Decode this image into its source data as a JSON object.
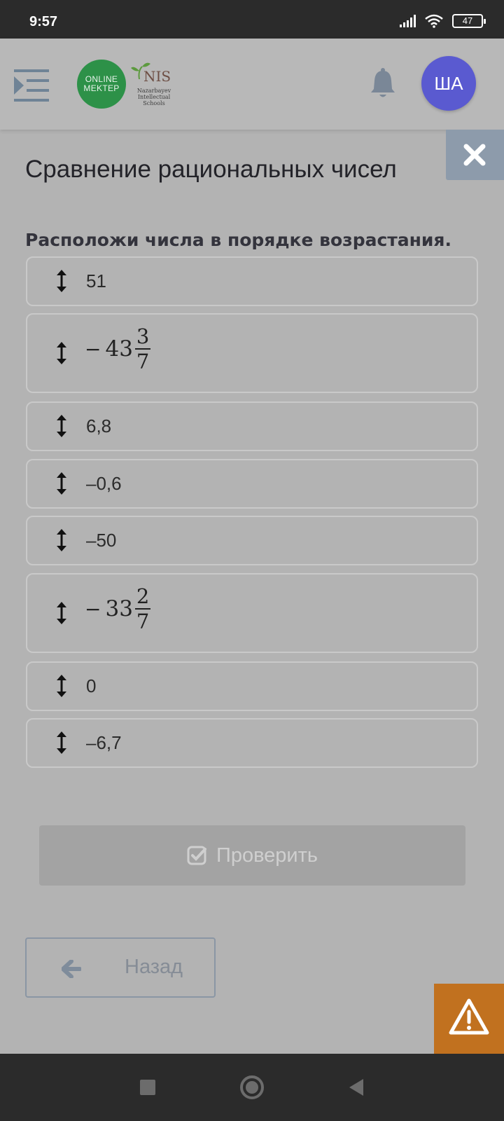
{
  "status_bar": {
    "time": "9:57",
    "battery": "47",
    "icons": [
      "signal-icon",
      "wifi-icon",
      "battery-icon"
    ]
  },
  "header": {
    "logo": {
      "line1": "ONLINE",
      "line2": "MEKTEP"
    },
    "partner_logo": {
      "title": "NIS",
      "line1": "Nazarbayev",
      "line2": "Intellectual",
      "line3": "Schools"
    },
    "avatar_initials": "ША",
    "icons": [
      "menu-icon",
      "bell-icon",
      "close-icon"
    ]
  },
  "page": {
    "title": "Сравнение рациональных чисел",
    "instruction": "Расположи числа в порядке возрастания."
  },
  "items": [
    {
      "text": "51"
    },
    {
      "sign": "−",
      "whole": "43",
      "num": "3",
      "den": "7"
    },
    {
      "text": "6,8"
    },
    {
      "text": "–0,6"
    },
    {
      "text": "–50"
    },
    {
      "sign": "−",
      "whole": "33",
      "num": "2",
      "den": "7"
    },
    {
      "text": "0"
    },
    {
      "text": "–6,7"
    }
  ],
  "buttons": {
    "check": "Проверить",
    "back": "Назад"
  },
  "colors": {
    "accent_green": "#2d9148",
    "avatar": "#5a5ad0",
    "report": "#c1711f",
    "close_tab": "#8d9bab"
  }
}
